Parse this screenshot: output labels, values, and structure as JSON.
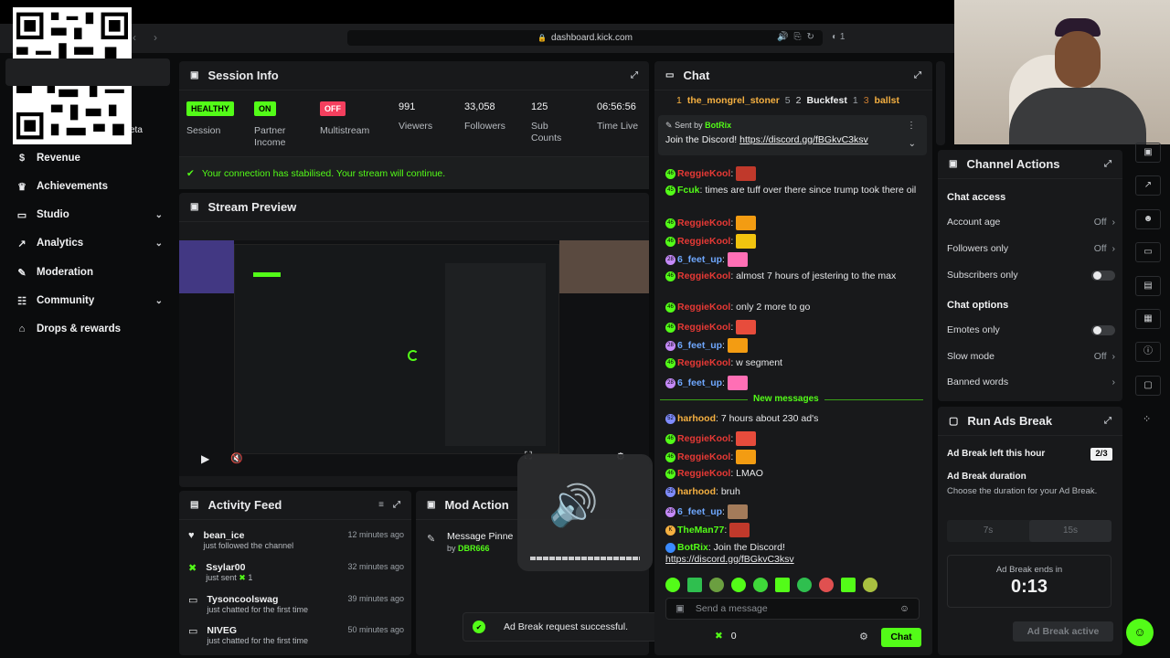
{
  "browser": {
    "url": "dashboard.kick.com",
    "tab_count": "1"
  },
  "sidebar": {
    "beta": "eta",
    "items": [
      {
        "label": "Revenue",
        "icon": "dollar-icon"
      },
      {
        "label": "Achievements",
        "icon": "trophy-icon"
      },
      {
        "label": "Studio",
        "icon": "studio-icon"
      },
      {
        "label": "Analytics",
        "icon": "analytics-icon"
      },
      {
        "label": "Moderation",
        "icon": "wrench-icon"
      },
      {
        "label": "Community",
        "icon": "community-icon"
      },
      {
        "label": "Drops & rewards",
        "icon": "gift-icon"
      }
    ]
  },
  "session": {
    "title": "Session Info",
    "stats": [
      {
        "badge": "HEALTHY",
        "label": "Session"
      },
      {
        "badge": "ON",
        "label": "Partner Income"
      },
      {
        "badge": "OFF",
        "label": "Multistream"
      },
      {
        "value": "991",
        "label": "Viewers"
      },
      {
        "value": "33,058",
        "label": "Followers"
      },
      {
        "value": "125",
        "label": "Sub Counts"
      },
      {
        "value": "06:56:56",
        "label": "Time Live"
      }
    ],
    "notice": "Your connection has stabilised. Your stream will continue."
  },
  "preview": {
    "title": "Stream Preview"
  },
  "activity": {
    "title": "Activity Feed",
    "items": [
      {
        "name": "bean_ice",
        "action": "just followed the channel",
        "time": "12 minutes ago"
      },
      {
        "name": "Ssylar00",
        "action": "just sent",
        "amount": "1",
        "time": "32 minutes ago"
      },
      {
        "name": "Tysoncoolswag",
        "action": "just chatted for the first time",
        "time": "39 minutes ago"
      },
      {
        "name": "NIVEG",
        "action": "just chatted for the first time",
        "time": "50 minutes ago"
      }
    ]
  },
  "mod_actions": {
    "title": "Mod Action",
    "item": "Message Pinne",
    "by": "by",
    "by_user": "DBR666"
  },
  "toast": {
    "text": "Ad Break request successful."
  },
  "chat": {
    "title": "Chat",
    "top_gifters": [
      {
        "rank": "1",
        "name": "the_mongrel_stoner",
        "count": "5"
      },
      {
        "rank": "2",
        "name": "Buckfest",
        "count": "1"
      },
      {
        "rank": "3",
        "name": "ballst",
        "count": ""
      }
    ],
    "pinned": {
      "sent_by": "Sent by",
      "user": "BotRix",
      "message": "Join the Discord!",
      "link": "https://discord.gg/fBGkvC3ksv"
    },
    "messages": [
      {
        "badge": "46",
        "user": "ReggieKool",
        "text": ": ",
        "emote": true
      },
      {
        "badge": "45",
        "user": "Fcuk",
        "text": ": times are tuff over there since trump took there oil"
      },
      {
        "badge": "46",
        "user": "ReggieKool",
        "text": ": ",
        "emote": true
      },
      {
        "badge": "46",
        "user": "ReggieKool",
        "text": ": ",
        "emote": true
      },
      {
        "badge": "28",
        "user": "6_feet_up",
        "text": ": ",
        "emote": true
      },
      {
        "badge": "46",
        "user": "ReggieKool",
        "text": ": almost 7 hours of jestering to the max"
      },
      {
        "badge": "46",
        "user": "ReggieKool",
        "text": ": only 2 more to go"
      },
      {
        "badge": "46",
        "user": "ReggieKool",
        "text": ": ",
        "emote": true
      },
      {
        "badge": "28",
        "user": "6_feet_up",
        "text": ": ",
        "emote": true
      },
      {
        "badge": "46",
        "user": "ReggieKool",
        "text": ": w segment"
      },
      {
        "badge": "28",
        "user": "6_feet_up",
        "text": ": ",
        "emote": true
      }
    ],
    "new_messages": "New messages",
    "messages2": [
      {
        "badge": "52",
        "user": "harhood",
        "text": ": 7 hours about 230 ad's"
      },
      {
        "badge": "46",
        "user": "ReggieKool",
        "text": ": ",
        "emote": true
      },
      {
        "badge": "46",
        "user": "ReggieKool",
        "text": ": ",
        "emote": true
      },
      {
        "badge": "46",
        "user": "ReggieKool",
        "text": ": LMAO"
      },
      {
        "badge": "52",
        "user": "harhood",
        "text": ": bruh"
      },
      {
        "badge": "28",
        "user": "6_feet_up",
        "text": ": ",
        "emote": true
      },
      {
        "badge": "K",
        "user": "TheMan77",
        "text": ": ",
        "emote": true
      },
      {
        "badge": "",
        "user": "BotRix",
        "text": ": Join the Discord!",
        "link": "https://discord.gg/fBGkvC3ksv"
      }
    ],
    "input_placeholder": "Send a message",
    "points": "0",
    "send": "Chat"
  },
  "channel_actions": {
    "title": "Channel Actions",
    "access_title": "Chat access",
    "account_age": "Account age",
    "account_age_v": "Off",
    "followers_only": "Followers only",
    "followers_only_v": "Off",
    "subscribers_only": "Subscribers only",
    "options_title": "Chat options",
    "emotes_only": "Emotes only",
    "slow_mode": "Slow mode",
    "slow_mode_v": "Off",
    "banned_words": "Banned words"
  },
  "ads": {
    "title": "Run Ads Break",
    "left_label": "Ad Break left this hour",
    "left_value": "2/3",
    "duration_title": "Ad Break duration",
    "duration_desc": "Choose the duration for your Ad Break.",
    "opt1": "7s",
    "opt2": "15s",
    "ends_label": "Ad Break ends in",
    "ends_value": "0:13",
    "active": "Ad Break active"
  },
  "colors": {
    "accent": "#53fc18",
    "red": "#f43f5e",
    "reggie": "#e53935",
    "feet": "#6fa8ff",
    "harhood": "#f5b041"
  }
}
